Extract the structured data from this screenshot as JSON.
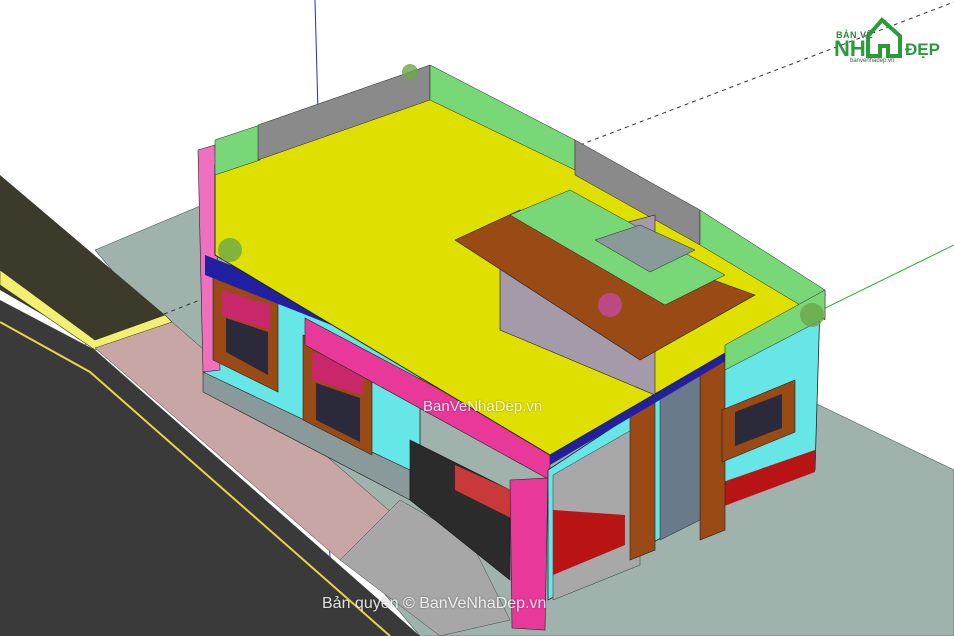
{
  "image": {
    "subject": "3D SketchUp model of a single-storey house with flat yellow roof, cyan and magenta walls, brown window frames, beside a street",
    "colors": {
      "roof": "#e0e000",
      "wall_cyan": "#66e6e6",
      "wall_magenta": "#e8389a",
      "frame_brown": "#9a4a14",
      "trim_blue": "#2020a0",
      "parapet_green": "#78d878",
      "ground": "#9fb3ac",
      "road": "#3a3a3a",
      "sidewalk": "#c7a3a3",
      "curb": "#f0f070"
    }
  },
  "logo": {
    "small_text": "BẢN VẼ",
    "big_text": "NH",
    "dep_text": "ĐẸP",
    "url_text": "banvenhadep.vn"
  },
  "watermarks": {
    "center": "BanVeNhaDep.vn",
    "bottom": "Bản quyền © BanVeNhaDep.vn"
  }
}
